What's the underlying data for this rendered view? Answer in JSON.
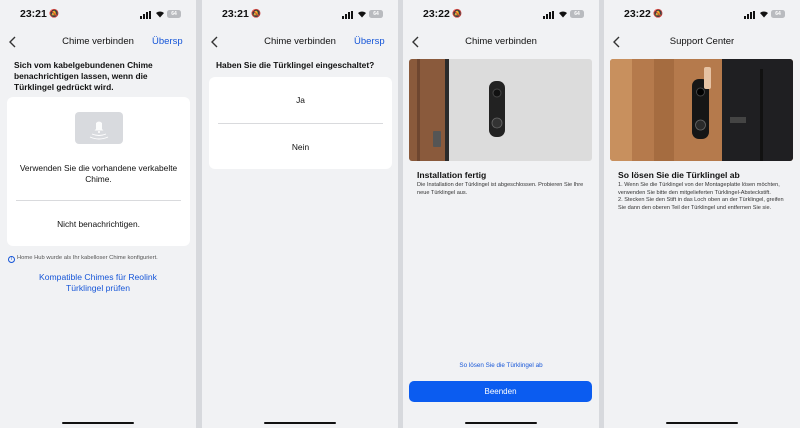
{
  "status": {
    "time1": "23:21",
    "time2": "23:21",
    "time3": "23:22",
    "time4": "23:22",
    "battery": "64"
  },
  "screen1": {
    "title": "Chime verbinden",
    "skip": "Übersp",
    "intro": "Sich vom kabelgebundenen Chime benachrichtigen lassen, wenn die Türklingel gedrückt wird.",
    "option_existing": "Verwenden Sie die vorhandene verkabelte Chime.",
    "option_none": "Nicht benachrichtigen.",
    "note": "Home Hub wurde als Ihr kabelloser Chime konfiguriert.",
    "link": "Kompatible Chimes für Reolink Türklingel prüfen"
  },
  "screen2": {
    "title": "Chime verbinden",
    "skip": "Übersp",
    "question": "Haben Sie die Türklingel eingeschaltet?",
    "yes": "Ja",
    "no": "Nein"
  },
  "screen3": {
    "title": "Chime verbinden",
    "heading": "Installation fertig",
    "body": "Die Installation der Türklingel ist abgeschlossen. Probieren Sie Ihre neue Türklingel aus.",
    "help_link": "So lösen Sie die Türklingel ab",
    "finish": "Beenden"
  },
  "screen4": {
    "title": "Support Center",
    "heading": "So lösen Sie die Türklingel ab",
    "step1": "1. Wenn Sie die Türklingel von der Montageplatte lösen möchten, verwenden Sie bitte den mitgelieferten Türklingel-Absteckstift.",
    "step2": "2. Stecken Sie den Stift in das Loch oben an der Türklingel, greifen Sie dann den oberen Teil der Türklingel und entfernen Sie sie."
  },
  "icons": [
    "back-chevron-icon",
    "bell-mute-icon",
    "signal-icon",
    "wifi-icon",
    "battery-icon",
    "chime-speaker-icon",
    "info-icon"
  ],
  "colors": {
    "accent": "#1656d8",
    "button": "#0b5cf0",
    "background": "#f1f2f4"
  }
}
